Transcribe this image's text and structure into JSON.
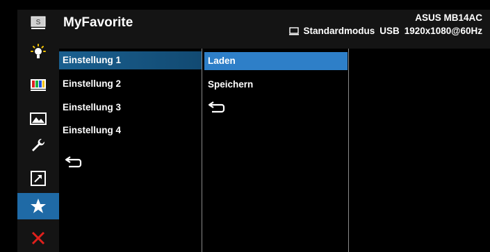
{
  "header": {
    "title": "MyFavorite",
    "model": "ASUS MB14AC",
    "mode": "Standardmodus",
    "input": "USB",
    "resolution": "1920x1080@60Hz"
  },
  "rail": {
    "icons": [
      "splendid-icon",
      "brightness-icon",
      "color-icon",
      "image-icon",
      "system-setup-icon",
      "shortcut-icon",
      "myfavorite-icon",
      "exit-icon"
    ],
    "selected": "myfavorite-icon"
  },
  "menu": {
    "items": [
      "Einstellung 1",
      "Einstellung 2",
      "Einstellung 3",
      "Einstellung 4"
    ],
    "selected_index": 0
  },
  "submenu": {
    "items": [
      "Laden",
      "Speichern"
    ],
    "selected_index": 0
  },
  "colors": {
    "menu_highlight": "#1a5f8f",
    "submenu_highlight": "#2e7fc8",
    "rail_selected": "#1f6aa6",
    "exit_icon": "#e0201c"
  }
}
